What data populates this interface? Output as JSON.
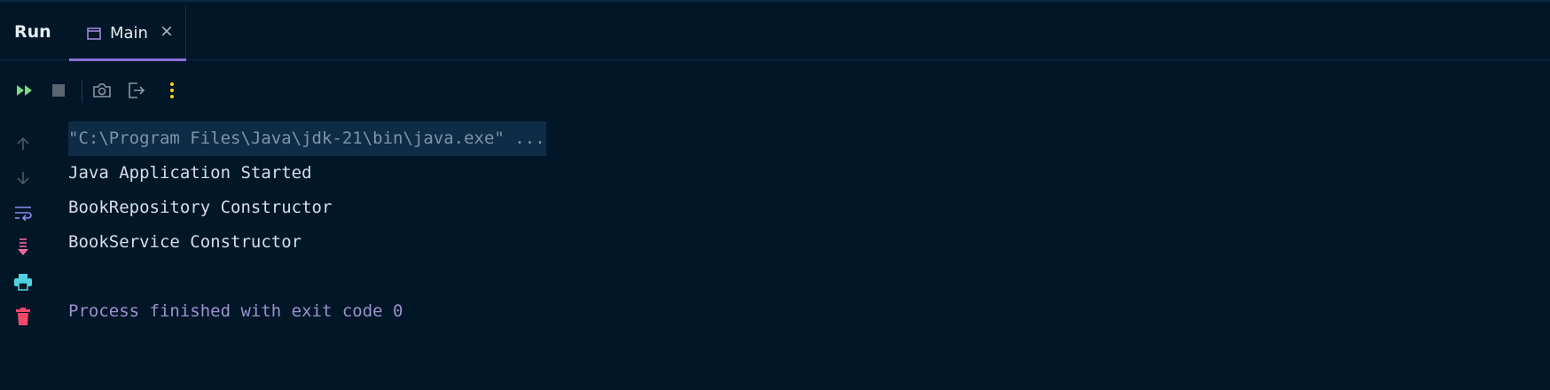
{
  "header": {
    "title": "Run",
    "tabs": [
      {
        "label": "Main",
        "active": true,
        "close_symbol": "×"
      }
    ]
  },
  "toolbar": {
    "buttons": [
      {
        "name": "rerun",
        "icon": "rerun-icon",
        "color": "#7fd97f"
      },
      {
        "name": "stop",
        "icon": "stop-icon",
        "color": "#5a6570"
      },
      {
        "name": "screenshot",
        "icon": "camera-icon",
        "color": "#8a97a5"
      },
      {
        "name": "exit",
        "icon": "exit-icon",
        "color": "#8a97a5"
      },
      {
        "name": "more",
        "icon": "more-vertical-icon",
        "color": "#ffd11a"
      }
    ]
  },
  "gutter": {
    "buttons": [
      {
        "name": "up",
        "icon": "arrow-up-icon",
        "color": "#4d5a66"
      },
      {
        "name": "down",
        "icon": "arrow-down-icon",
        "color": "#4d5a66"
      },
      {
        "name": "soft-wrap",
        "icon": "soft-wrap-icon",
        "color": "#8c8cf0"
      },
      {
        "name": "scroll-to-end",
        "icon": "scroll-to-end-icon",
        "color": "#f06aa0"
      },
      {
        "name": "print",
        "icon": "print-icon",
        "color": "#4fd1e0"
      },
      {
        "name": "clear",
        "icon": "trash-icon",
        "color": "#f0476a"
      }
    ]
  },
  "console": {
    "command": "\"C:\\Program Files\\Java\\jdk-21\\bin\\java.exe\" ...",
    "output": [
      "Java Application Started",
      "BookRepository Constructor",
      "BookService Constructor"
    ],
    "exit_message": "Process finished with exit code 0"
  },
  "colors": {
    "background": "#011627",
    "tab_accent": "#8c6fd8",
    "command_text": "#7e93a8",
    "output_text": "#d6deeb",
    "exit_text": "#9c92ce"
  }
}
